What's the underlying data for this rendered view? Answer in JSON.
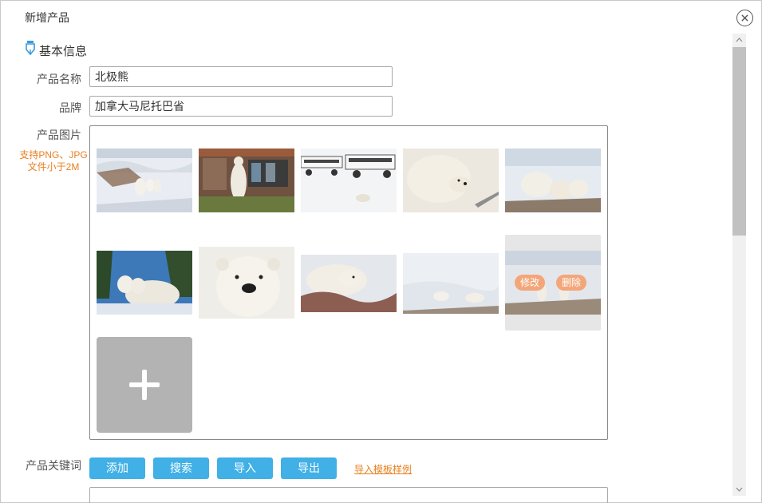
{
  "dialog": {
    "title": "新增产品",
    "close_icon": "close-circle-icon"
  },
  "section": {
    "title": "基本信息",
    "icon": "pen-marker-icon"
  },
  "form": {
    "name_label": "产品名称",
    "name_value": "北极熊",
    "brand_label": "品牌",
    "brand_value": "加拿大马尼托巴省",
    "images_label": "产品图片",
    "images_hint_line1": "支持PNG、JPG",
    "images_hint_line2": "文件小于2M",
    "keywords_label": "产品关键词"
  },
  "gallery": {
    "images": [
      "polar-bear-family-walking-photo",
      "polar-bear-standing-by-lodge-photo",
      "tundra-buggy-vehicles-photo",
      "polar-bear-closeup-by-vehicle-photo",
      "polar-bear-cubs-group-photo",
      "polar-bear-mother-cubs-den-photo",
      "polar-bear-face-closeup-photo",
      "polar-bear-in-brush-photo",
      "polar-bears-resting-snow-photo",
      "polar-bears-selected-photo"
    ],
    "edit_label": "修改",
    "delete_label": "删除",
    "add_icon": "plus-icon"
  },
  "keywords": {
    "add_label": "添加",
    "search_label": "搜索",
    "import_label": "导入",
    "export_label": "导出",
    "template_link": "导入模板样例"
  },
  "colors": {
    "primary_button": "#40b0e6",
    "accent_orange": "#e8801f",
    "overlay_button": "#f3a67a"
  }
}
